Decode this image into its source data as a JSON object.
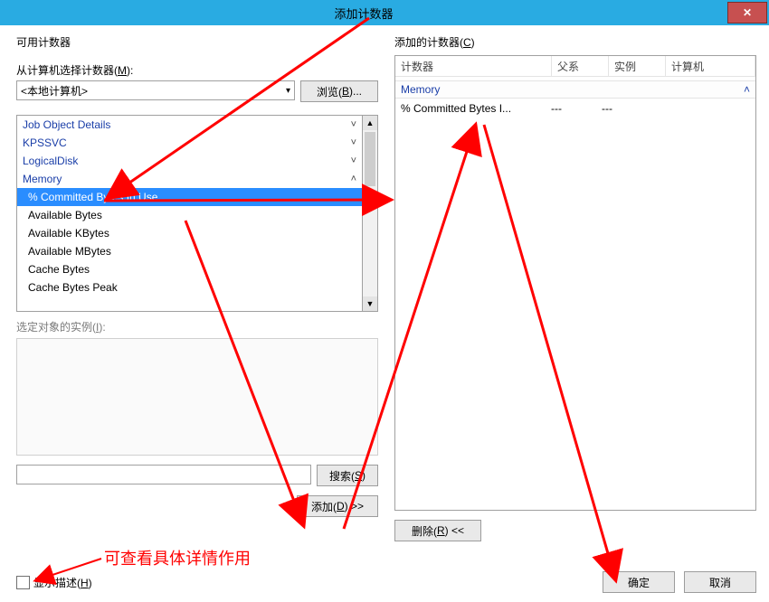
{
  "title": "添加计数器",
  "left": {
    "group_label_prefix": "可用计数器",
    "from_label_prefix": "从计算机选择计数器(",
    "from_label_u": "M",
    "from_label_suffix": "):",
    "computer_select_value": "<本地计算机>",
    "browse_label_prefix": "浏览(",
    "browse_label_u": "B",
    "browse_label_suffix": ")...",
    "categories": [
      {
        "name": "Job Object Details",
        "expanded": false
      },
      {
        "name": "KPSSVC",
        "expanded": false
      },
      {
        "name": "LogicalDisk",
        "expanded": false
      },
      {
        "name": "Memory",
        "expanded": true
      }
    ],
    "memory_counters": [
      {
        "name": "% Committed Bytes In Use",
        "selected": true
      },
      {
        "name": "Available Bytes",
        "selected": false
      },
      {
        "name": "Available KBytes",
        "selected": false
      },
      {
        "name": "Available MBytes",
        "selected": false
      },
      {
        "name": "Cache Bytes",
        "selected": false
      },
      {
        "name": "Cache Bytes Peak",
        "selected": false,
        "clipped_name": "Cache Bytes Peak"
      }
    ],
    "instances_label_prefix": "选定对象的实例(",
    "instances_label_u": "I",
    "instances_label_suffix": "):",
    "search_label_prefix": "搜索(",
    "search_label_u": "S",
    "search_label_suffix": ")",
    "add_label_prefix": "添加(",
    "add_label_u": "D",
    "add_label_suffix": ") >>"
  },
  "right": {
    "group_label_prefix": "添加的计数器(",
    "group_label_u": "C",
    "group_label_suffix": ")",
    "headers": {
      "counter": "计数器",
      "parent": "父系",
      "instance": "实例",
      "computer": "计算机"
    },
    "group_name": "Memory",
    "rows": [
      {
        "counter": "% Committed Bytes I...",
        "parent": "---",
        "instance": "---"
      }
    ],
    "remove_label_prefix": "删除(",
    "remove_label_u": "R",
    "remove_label_suffix": ") <<"
  },
  "footer": {
    "show_desc_prefix": "显示描述(",
    "show_desc_u": "H",
    "show_desc_suffix": ")",
    "ok": "确定",
    "cancel": "取消"
  },
  "annotation_text": "可查看具体详情作用"
}
